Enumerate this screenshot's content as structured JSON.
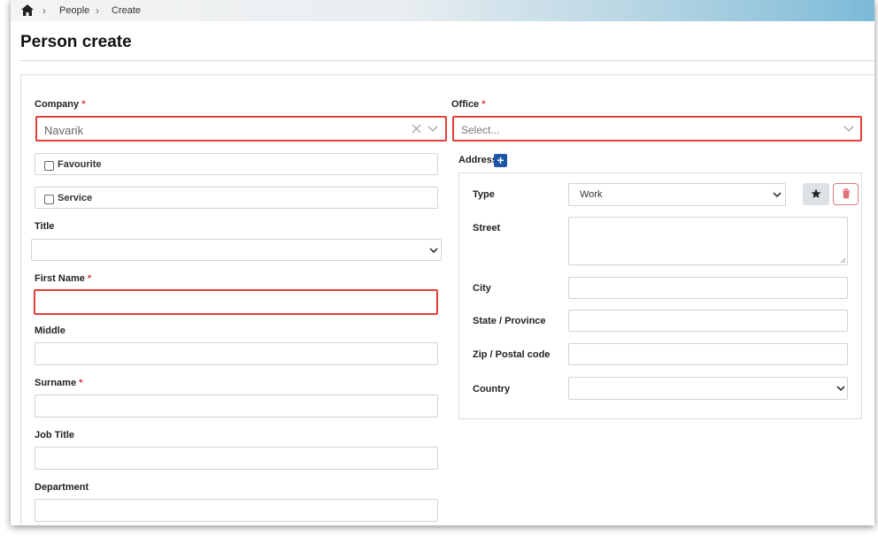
{
  "breadcrumb": {
    "items": [
      "People",
      "Create"
    ]
  },
  "page": {
    "title": "Person create"
  },
  "form": {
    "company": {
      "label": "Company",
      "required_mark": "*",
      "value": "Navarik"
    },
    "office": {
      "label": "Office",
      "required_mark": "*",
      "placeholder": "Select..."
    },
    "favourite": {
      "label": "Favourite",
      "checked": false
    },
    "service": {
      "label": "Service",
      "checked": false
    },
    "title": {
      "label": "Title",
      "value": ""
    },
    "first_name": {
      "label": "First Name",
      "required_mark": "*",
      "value": ""
    },
    "middle": {
      "label": "Middle",
      "value": ""
    },
    "surname": {
      "label": "Surname",
      "required_mark": "*",
      "value": ""
    },
    "job_title": {
      "label": "Job Title",
      "value": ""
    },
    "department": {
      "label": "Department",
      "value": ""
    }
  },
  "address": {
    "label": "Address",
    "add_icon": "plus-icon",
    "type": {
      "label": "Type",
      "value": "Work"
    },
    "street": {
      "label": "Street",
      "value": ""
    },
    "city": {
      "label": "City",
      "value": ""
    },
    "state": {
      "label": "State / Province",
      "value": ""
    },
    "zip": {
      "label": "Zip / Postal code",
      "value": ""
    },
    "country": {
      "label": "Country",
      "value": ""
    }
  },
  "icons": {
    "home": "home-icon",
    "separator": "chevron-right-icon",
    "clear": "close-icon",
    "dropdown": "chevron-down-icon",
    "star": "star-icon",
    "trash": "trash-icon"
  },
  "colors": {
    "invalid_border": "#e2403b",
    "required": "#dc3545",
    "primary": "#1a57a8",
    "danger": "#dc3545"
  }
}
